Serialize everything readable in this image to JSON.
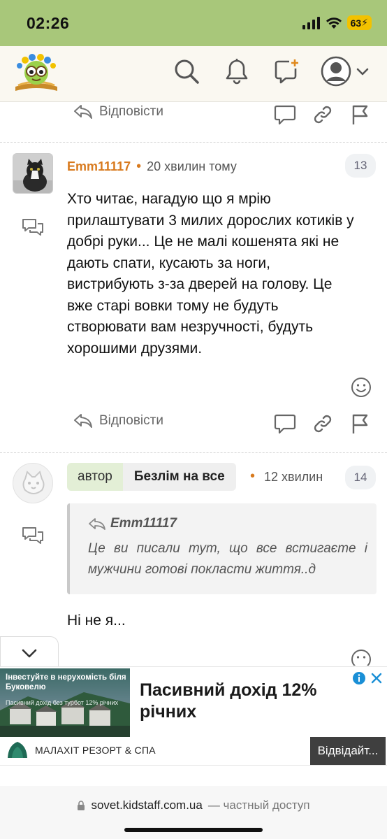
{
  "status_bar": {
    "time": "02:26",
    "battery": "63"
  },
  "comments": [
    {
      "reply_label": "Відповісти"
    },
    {
      "author": "Emm11117",
      "time": "20 хвилин тому",
      "count": "13",
      "text": "Хто читає, нагадую що я мрію прилаштувати 3 милих дорослих котиків у добрі руки... Це не малі кошенята які не дають спати, кусають за ноги, вистрибують з-за дверей на голову. Це вже старі вовки тому не будуть створювати вам незручності, будуть хорошими друзями.",
      "reply_label": "Відповісти"
    },
    {
      "author_tag": "автор",
      "author": "Безлім на все",
      "time": "12 хвилин",
      "count": "14",
      "quote": {
        "author": "Emm11117",
        "text": "Це ви писали тут, що все встигаєте і мужчини готові покласти життя..д"
      },
      "text": "Ні не я..."
    }
  ],
  "ad": {
    "image_line1": "Інвестуйте в нерухомість біля Буковелю",
    "image_line2": "Пасивний дохід без турбот 12% річних",
    "headline": "Пасивний дохід 12% річних",
    "brand": "МАЛАХІТ РЕЗОРТ & СПА",
    "cta": "Відвідайт..."
  },
  "url_bar": {
    "domain": "sovet.kidstaff.com.ua",
    "suffix": "— частный доступ"
  },
  "colors": {
    "status_bar": "#a8c77a",
    "author_accent": "#d87a1e",
    "tag_author_bg": "#e3efd6"
  }
}
